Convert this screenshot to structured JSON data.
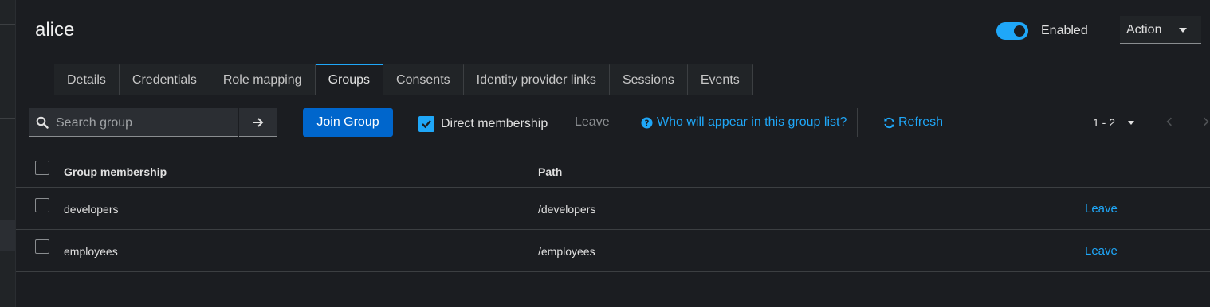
{
  "header": {
    "title": "alice",
    "enabled_label": "Enabled",
    "action_label": "Action"
  },
  "tabs": [
    {
      "label": "Details"
    },
    {
      "label": "Credentials"
    },
    {
      "label": "Role mapping"
    },
    {
      "label": "Groups",
      "active": true
    },
    {
      "label": "Consents"
    },
    {
      "label": "Identity provider links"
    },
    {
      "label": "Sessions"
    },
    {
      "label": "Events"
    }
  ],
  "toolbar": {
    "search_placeholder": "Search group",
    "join_group": "Join Group",
    "direct_membership": "Direct membership",
    "leave": "Leave",
    "help": "Who will appear in this group list?",
    "refresh": "Refresh",
    "pagination": "1 - 2"
  },
  "table": {
    "columns": [
      "Group membership",
      "Path"
    ],
    "rows": [
      {
        "name": "developers",
        "path": "/developers",
        "action": "Leave"
      },
      {
        "name": "employees",
        "path": "/employees",
        "action": "Leave"
      }
    ]
  },
  "colors": {
    "accent": "#1fa7f8",
    "primary_button": "#0066cc",
    "background": "#1b1d21"
  }
}
